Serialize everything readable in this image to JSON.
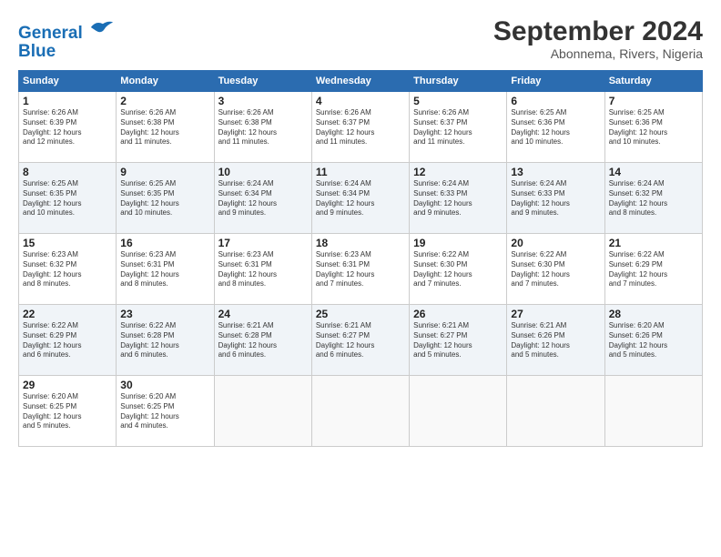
{
  "header": {
    "logo_line1": "General",
    "logo_line2": "Blue",
    "month": "September 2024",
    "location": "Abonnema, Rivers, Nigeria"
  },
  "weekdays": [
    "Sunday",
    "Monday",
    "Tuesday",
    "Wednesday",
    "Thursday",
    "Friday",
    "Saturday"
  ],
  "weeks": [
    [
      {
        "day": "1",
        "info": "Sunrise: 6:26 AM\nSunset: 6:39 PM\nDaylight: 12 hours\nand 12 minutes."
      },
      {
        "day": "2",
        "info": "Sunrise: 6:26 AM\nSunset: 6:38 PM\nDaylight: 12 hours\nand 11 minutes."
      },
      {
        "day": "3",
        "info": "Sunrise: 6:26 AM\nSunset: 6:38 PM\nDaylight: 12 hours\nand 11 minutes."
      },
      {
        "day": "4",
        "info": "Sunrise: 6:26 AM\nSunset: 6:37 PM\nDaylight: 12 hours\nand 11 minutes."
      },
      {
        "day": "5",
        "info": "Sunrise: 6:26 AM\nSunset: 6:37 PM\nDaylight: 12 hours\nand 11 minutes."
      },
      {
        "day": "6",
        "info": "Sunrise: 6:25 AM\nSunset: 6:36 PM\nDaylight: 12 hours\nand 10 minutes."
      },
      {
        "day": "7",
        "info": "Sunrise: 6:25 AM\nSunset: 6:36 PM\nDaylight: 12 hours\nand 10 minutes."
      }
    ],
    [
      {
        "day": "8",
        "info": "Sunrise: 6:25 AM\nSunset: 6:35 PM\nDaylight: 12 hours\nand 10 minutes."
      },
      {
        "day": "9",
        "info": "Sunrise: 6:25 AM\nSunset: 6:35 PM\nDaylight: 12 hours\nand 10 minutes."
      },
      {
        "day": "10",
        "info": "Sunrise: 6:24 AM\nSunset: 6:34 PM\nDaylight: 12 hours\nand 9 minutes."
      },
      {
        "day": "11",
        "info": "Sunrise: 6:24 AM\nSunset: 6:34 PM\nDaylight: 12 hours\nand 9 minutes."
      },
      {
        "day": "12",
        "info": "Sunrise: 6:24 AM\nSunset: 6:33 PM\nDaylight: 12 hours\nand 9 minutes."
      },
      {
        "day": "13",
        "info": "Sunrise: 6:24 AM\nSunset: 6:33 PM\nDaylight: 12 hours\nand 9 minutes."
      },
      {
        "day": "14",
        "info": "Sunrise: 6:24 AM\nSunset: 6:32 PM\nDaylight: 12 hours\nand 8 minutes."
      }
    ],
    [
      {
        "day": "15",
        "info": "Sunrise: 6:23 AM\nSunset: 6:32 PM\nDaylight: 12 hours\nand 8 minutes."
      },
      {
        "day": "16",
        "info": "Sunrise: 6:23 AM\nSunset: 6:31 PM\nDaylight: 12 hours\nand 8 minutes."
      },
      {
        "day": "17",
        "info": "Sunrise: 6:23 AM\nSunset: 6:31 PM\nDaylight: 12 hours\nand 8 minutes."
      },
      {
        "day": "18",
        "info": "Sunrise: 6:23 AM\nSunset: 6:31 PM\nDaylight: 12 hours\nand 7 minutes."
      },
      {
        "day": "19",
        "info": "Sunrise: 6:22 AM\nSunset: 6:30 PM\nDaylight: 12 hours\nand 7 minutes."
      },
      {
        "day": "20",
        "info": "Sunrise: 6:22 AM\nSunset: 6:30 PM\nDaylight: 12 hours\nand 7 minutes."
      },
      {
        "day": "21",
        "info": "Sunrise: 6:22 AM\nSunset: 6:29 PM\nDaylight: 12 hours\nand 7 minutes."
      }
    ],
    [
      {
        "day": "22",
        "info": "Sunrise: 6:22 AM\nSunset: 6:29 PM\nDaylight: 12 hours\nand 6 minutes."
      },
      {
        "day": "23",
        "info": "Sunrise: 6:22 AM\nSunset: 6:28 PM\nDaylight: 12 hours\nand 6 minutes."
      },
      {
        "day": "24",
        "info": "Sunrise: 6:21 AM\nSunset: 6:28 PM\nDaylight: 12 hours\nand 6 minutes."
      },
      {
        "day": "25",
        "info": "Sunrise: 6:21 AM\nSunset: 6:27 PM\nDaylight: 12 hours\nand 6 minutes."
      },
      {
        "day": "26",
        "info": "Sunrise: 6:21 AM\nSunset: 6:27 PM\nDaylight: 12 hours\nand 5 minutes."
      },
      {
        "day": "27",
        "info": "Sunrise: 6:21 AM\nSunset: 6:26 PM\nDaylight: 12 hours\nand 5 minutes."
      },
      {
        "day": "28",
        "info": "Sunrise: 6:20 AM\nSunset: 6:26 PM\nDaylight: 12 hours\nand 5 minutes."
      }
    ],
    [
      {
        "day": "29",
        "info": "Sunrise: 6:20 AM\nSunset: 6:25 PM\nDaylight: 12 hours\nand 5 minutes."
      },
      {
        "day": "30",
        "info": "Sunrise: 6:20 AM\nSunset: 6:25 PM\nDaylight: 12 hours\nand 4 minutes."
      },
      null,
      null,
      null,
      null,
      null
    ]
  ]
}
